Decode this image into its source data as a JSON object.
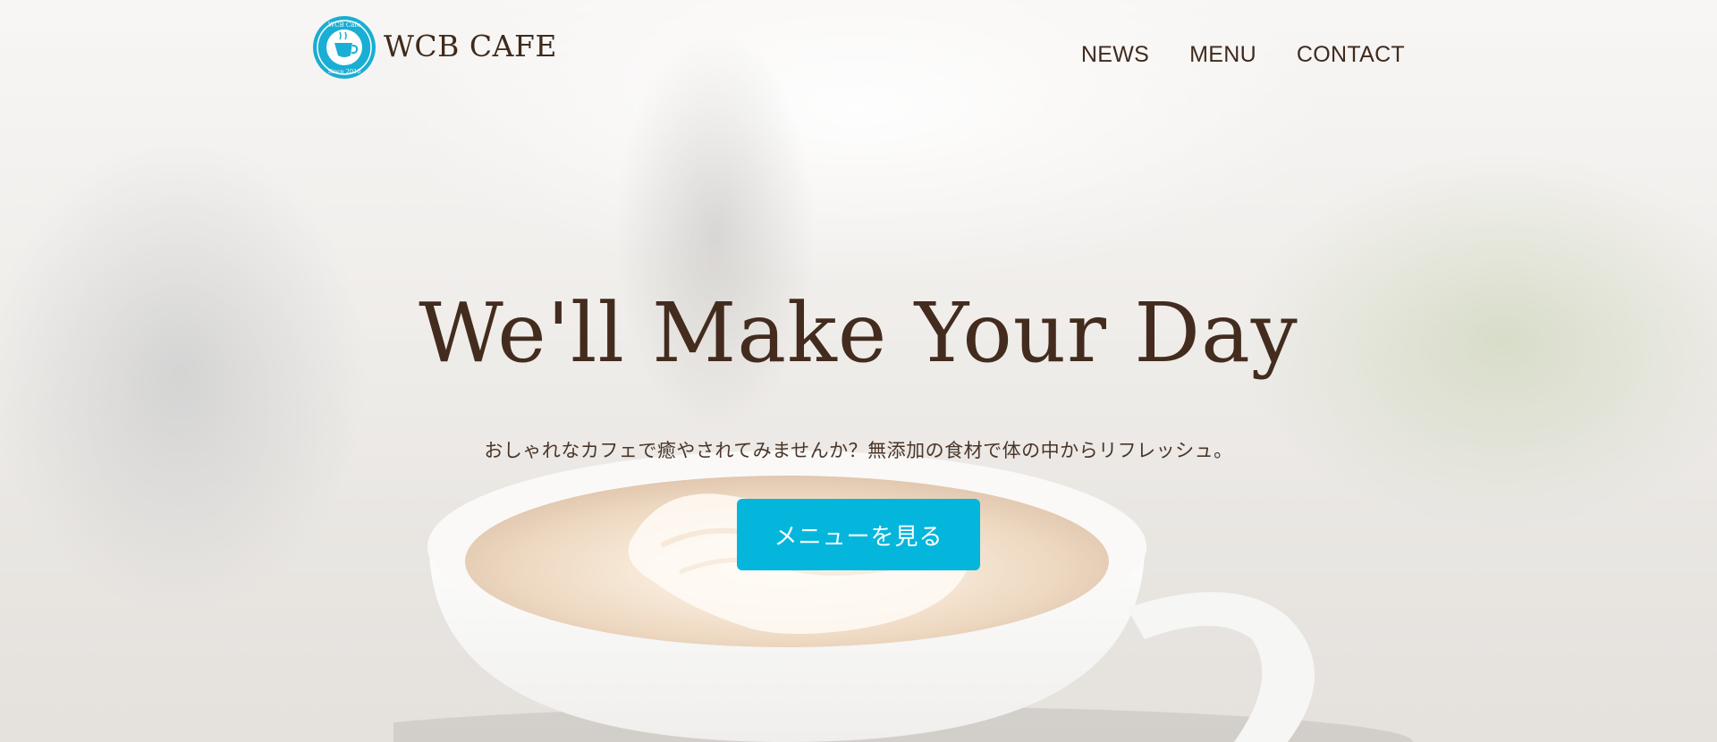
{
  "header": {
    "logo_text": "WCB CAFE",
    "logo_badge_top": "WCB Cafe",
    "logo_badge_bottom": "Since 2010"
  },
  "nav": {
    "items": [
      {
        "label": "NEWS"
      },
      {
        "label": "MENU"
      },
      {
        "label": "CONTACT"
      }
    ]
  },
  "hero": {
    "title": "We'll Make Your Day",
    "subtitle": "おしゃれなカフェで癒やされてみませんか？無添加の食材で体の中からリフレッシュ。",
    "cta_label": "メニューを見る"
  },
  "colors": {
    "accent": "#04b6dc",
    "text": "#432c1e",
    "cta_text": "#ffffff"
  },
  "icons": {
    "logo": "coffee-cup-badge-icon"
  }
}
